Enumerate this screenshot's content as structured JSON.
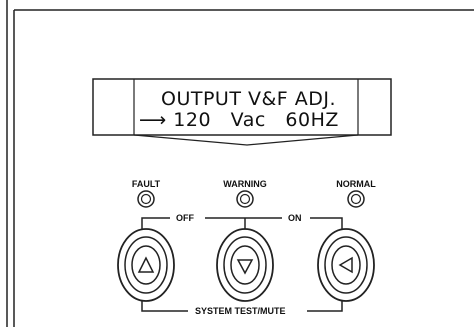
{
  "display": {
    "line1": "OUTPUT V&F ADJ.",
    "line2_arrow": "⟶",
    "line2_text": "120   Vac   60HZ"
  },
  "indicators": [
    {
      "id": "fault",
      "label": "FAULT"
    },
    {
      "id": "warning",
      "label": "WARNING"
    },
    {
      "id": "normal",
      "label": "NORMAL"
    }
  ],
  "button_group": {
    "off_label": "OFF",
    "on_label": "ON",
    "bottom_label": "SYSTEM TEST/MUTE"
  },
  "buttons": [
    {
      "id": "up",
      "icon": "triangle-up-icon"
    },
    {
      "id": "down",
      "icon": "triangle-down-icon"
    },
    {
      "id": "left",
      "icon": "triangle-left-icon"
    }
  ]
}
